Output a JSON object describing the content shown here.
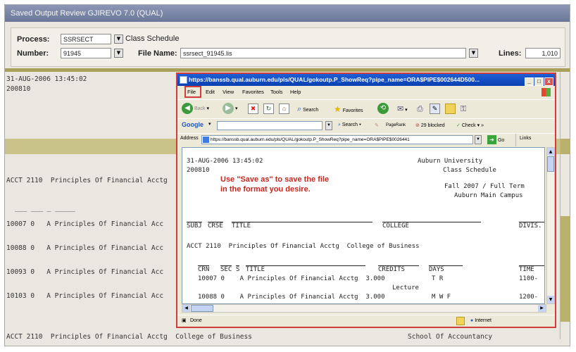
{
  "background_window": {
    "title": "Saved Output Review  GJIREVO  7.0  (QUAL)",
    "process_label": "Process:",
    "process_value": "SSRSECT",
    "process_desc": "Class Schedule",
    "number_label": "Number:",
    "number_value": "91945",
    "file_name_label": "File Name:",
    "file_name_value": "ssrsect_91945.lis",
    "lines_label": "Lines:",
    "lines_value": "1,010",
    "timestamp": "31-AUG-2006 13:45:02",
    "term": "200810",
    "course_line": "ACCT 2110  Principles Of Financial Acctg",
    "dash_fragment": "___ ___ _ _____",
    "rows": [
      "10007 0   A Principles Of Financial Acc",
      "10088 0   A Principles Of Financial Acc",
      "10093 0   A Principles Of Financial Acc",
      "10103 0   A Principles Of Financial Acc"
    ],
    "bottom_line_left": "ACCT 2110  Principles Of Financial Acctg  College of Business",
    "bottom_line_right": "School Of Accountancy"
  },
  "ie_window": {
    "title": "https://banssb.qual.auburn.edu/pls/QUAL/gokoutp.P_ShowReq?pipe_name=ORA$PIPE$002644D500...",
    "window_buttons": [
      "_",
      "□",
      "x"
    ],
    "menu": [
      "File",
      "Edit",
      "View",
      "Favorites",
      "Tools",
      "Help"
    ],
    "toolbar": {
      "back": "Back",
      "search": "Search",
      "favorites": "Favorites"
    },
    "google_bar": {
      "logo": "Google",
      "search": "Search",
      "pagerank": "PageRank",
      "blocked": "29 blocked",
      "check": "Check"
    },
    "address_label": "Address",
    "address_value": "https://banssb.qual.auburn.edu/pls/QUAL/gokoutp.P_ShowReq?pipe_name=ORA$PIPE$0026441",
    "go_label": "Go",
    "links_label": "Links",
    "status_left": "Done",
    "status_right": "Internet"
  },
  "report": {
    "timestamp": "31-AUG-2006 13:45:02",
    "term": "200810",
    "university": "Auburn University",
    "schedule_title": "Class Schedule",
    "term_name": "Fall 2007 / Full Term",
    "campus": "Auburn Main Campus",
    "headers": {
      "subj": "SUBJ",
      "crse": "CRSE",
      "title": "TITLE",
      "college": "COLLEGE",
      "divis": "DIVIS."
    },
    "course": "ACCT 2110  Principles Of Financial Acctg  College of Business",
    "section_headers": {
      "crn": "CRN",
      "sec": "SEC",
      "s": "S",
      "title": "TITLE",
      "credits": "CREDITS",
      "days": "DAYS",
      "time": "TIME"
    },
    "rows": [
      {
        "line": "10007 0    A Principles Of Financial Acctg  3.000",
        "days": "T R",
        "time": "1100-"
      },
      {
        "line": "10088 0    A Principles Of Financial Acctg  3.000",
        "days": "M W F",
        "time": "1200-"
      }
    ],
    "lecture_label": "Lecture"
  },
  "annotation": {
    "line1": "Use \"Save as\" to save the file",
    "line2": "in the format you desire.",
    "color": "#c8261f"
  }
}
